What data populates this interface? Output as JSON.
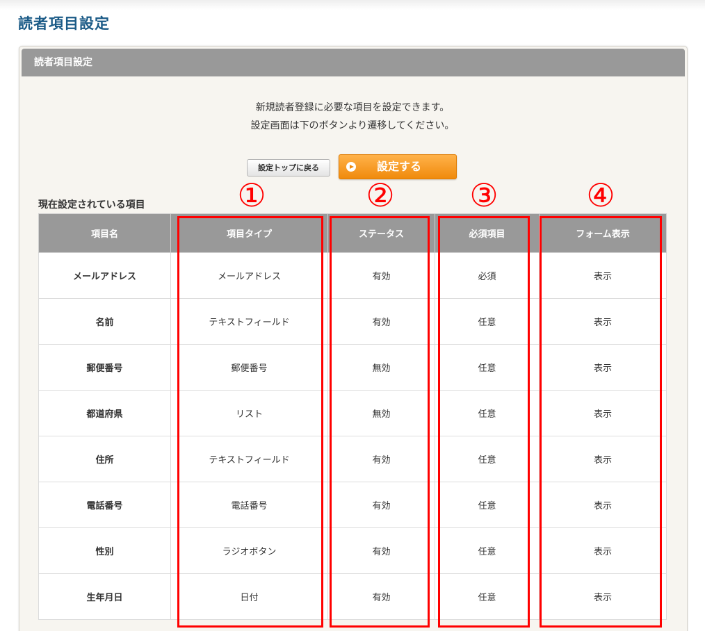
{
  "page_title": "読者項目設定",
  "panel": {
    "heading": "読者項目設定",
    "intro_line1": "新規読者登録に必要な項目を設定できます。",
    "intro_line2": "設定画面は下のボタンより遷移してください。",
    "back_button": "設定トップに戻る",
    "set_button": "設定する",
    "table_caption": "現在設定されている項目"
  },
  "table": {
    "headers": [
      "項目名",
      "項目タイプ",
      "ステータス",
      "必須項目",
      "フォーム表示"
    ],
    "rows": [
      [
        "メールアドレス",
        "メールアドレス",
        "有効",
        "必須",
        "表示"
      ],
      [
        "名前",
        "テキストフィールド",
        "有効",
        "任意",
        "表示"
      ],
      [
        "郵便番号",
        "郵便番号",
        "無効",
        "任意",
        "表示"
      ],
      [
        "都道府県",
        "リスト",
        "無効",
        "任意",
        "表示"
      ],
      [
        "住所",
        "テキストフィールド",
        "有効",
        "任意",
        "表示"
      ],
      [
        "電話番号",
        "電話番号",
        "有効",
        "任意",
        "表示"
      ],
      [
        "性別",
        "ラジオボタン",
        "有効",
        "任意",
        "表示"
      ],
      [
        "生年月日",
        "日付",
        "有効",
        "任意",
        "表示"
      ]
    ]
  },
  "annotations": [
    "①",
    "②",
    "③",
    "④"
  ],
  "colors": {
    "title": "#1a5a86",
    "header_gray": "#999999",
    "accent_orange": "#f08a0c",
    "annotation_red": "#ff0000"
  }
}
